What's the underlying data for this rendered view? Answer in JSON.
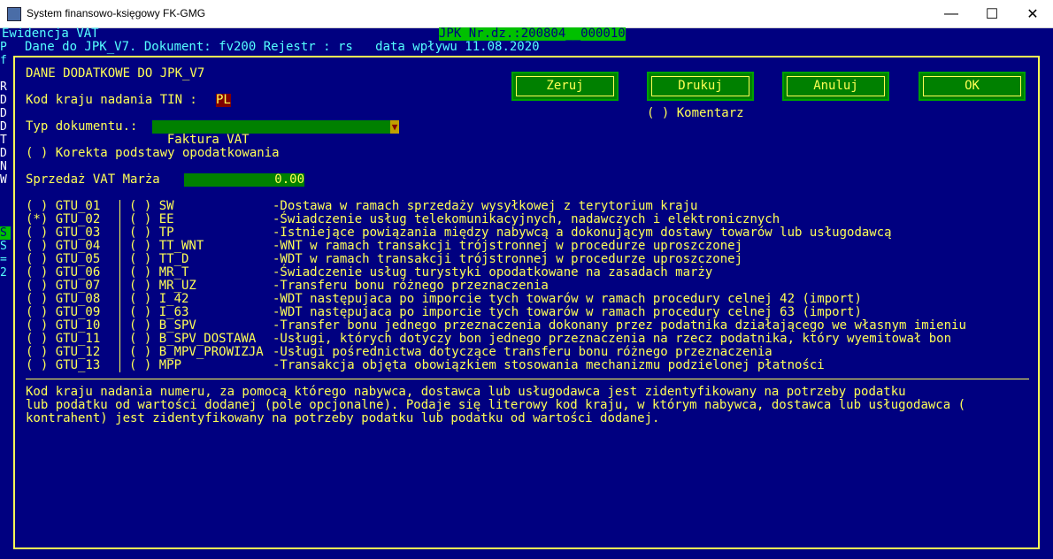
{
  "window": {
    "title": "System finansowo-księgowy FK-GMG",
    "minimize_glyph": "—",
    "maximize_glyph": "☐",
    "close_glyph": "✕"
  },
  "background": {
    "header_left": "Ewidencja VAT",
    "jpk_nr": "JPK Nr.dz.:200804__000010",
    "doc_info": "Dane do JPK_V7. Dokument: fv200 Rejestr : rs   data wpływu 11.08.2020",
    "side_letters": [
      "P",
      "f",
      "R",
      "D",
      "D",
      "D",
      "T",
      "D",
      "N",
      "W",
      "S",
      "S",
      "=",
      "2"
    ]
  },
  "dialog": {
    "heading": "DANE DODATKOWE DO JPK_V7",
    "tin_label": "Kod kraju nadania TIN :",
    "tin_value": "PL",
    "doc_type_label": "Typ dokumentu.:",
    "doc_type_value": "Faktura VAT",
    "doc_type_arrow": "▼",
    "korekta_label": "( ) Korekta podstawy opodatkowania",
    "marza_label": "Sprzedaż VAT Marża",
    "marza_value": "0.00",
    "buttons": {
      "zeruj": "Zeruj",
      "drukuj": "Drukuj",
      "anuluj": "Anuluj",
      "ok": "OK"
    },
    "komentarz": "( ) Komentarz",
    "gtu_rows": [
      {
        "gtu": "( ) GTU_01",
        "code": "( ) SW",
        "desc": "-Dostawa w ramach sprzedaży wysyłkowej z terytorium kraju"
      },
      {
        "gtu": "(*) GTU_02",
        "code": "( ) EE",
        "desc": "-Świadczenie usług telekomunikacyjnych, nadawczych i elektronicznych"
      },
      {
        "gtu": "( ) GTU_03",
        "code": "( ) TP",
        "desc": "-Istniejące powiązania między nabywcą a dokonującym dostawy towarów lub usługodawcą"
      },
      {
        "gtu": "( ) GTU_04",
        "code": "( ) TT_WNT",
        "desc": "-WNT w ramach transakcji trójstronnej w procedurze uproszczonej"
      },
      {
        "gtu": "( ) GTU_05",
        "code": "( ) TT_D",
        "desc": "-WDT w ramach transakcji trójstronnej w procedurze uproszczonej"
      },
      {
        "gtu": "( ) GTU_06",
        "code": "( ) MR_T",
        "desc": "-Świadczenie usług turystyki opodatkowane na zasadach marży"
      },
      {
        "gtu": "( ) GTU_07",
        "code": "( ) MR_UZ",
        "desc": "-Transferu bonu różnego przeznaczenia"
      },
      {
        "gtu": "( ) GTU_08",
        "code": "( ) I_42",
        "desc": "-WDT następujaca po imporcie tych towarów w ramach procedury celnej 42 (import)"
      },
      {
        "gtu": "( ) GTU_09",
        "code": "( ) I_63",
        "desc": "-WDT następujaca po imporcie tych towarów w ramach procedury celnej 63 (import)"
      },
      {
        "gtu": "( ) GTU_10",
        "code": "( ) B_SPV",
        "desc": "-Transfer bonu jednego przeznaczenia dokonany przez podatnika działającego we własnym imieniu"
      },
      {
        "gtu": "( ) GTU_11",
        "code": "( ) B_SPV_DOSTAWA",
        "desc": "-Usługi, których dotyczy bon jednego przeznaczenia na rzecz podatnika, który wyemitował bon"
      },
      {
        "gtu": "( ) GTU_12",
        "code": "( ) B_MPV_PROWIZJA",
        "desc": "-Usługi pośrednictwa dotyczące transferu bonu różnego przeznaczenia"
      },
      {
        "gtu": "( ) GTU_13",
        "code": "( ) MPP",
        "desc": "-Transakcja objęta obowiązkiem stosowania mechanizmu podzielonej płatności"
      }
    ],
    "help_lines": [
      "Kod kraju nadania numeru, za pomocą którego nabywca, dostawca lub usługodawca jest zidentyfikowany na potrzeby podatku",
      "lub podatku od wartości dodanej (pole opcjonalne). Podaje się literowy kod kraju, w którym nabywca, dostawca lub usługodawca (",
      "kontrahent) jest zidentyfikowany na potrzeby podatku lub podatku od wartości dodanej."
    ]
  }
}
